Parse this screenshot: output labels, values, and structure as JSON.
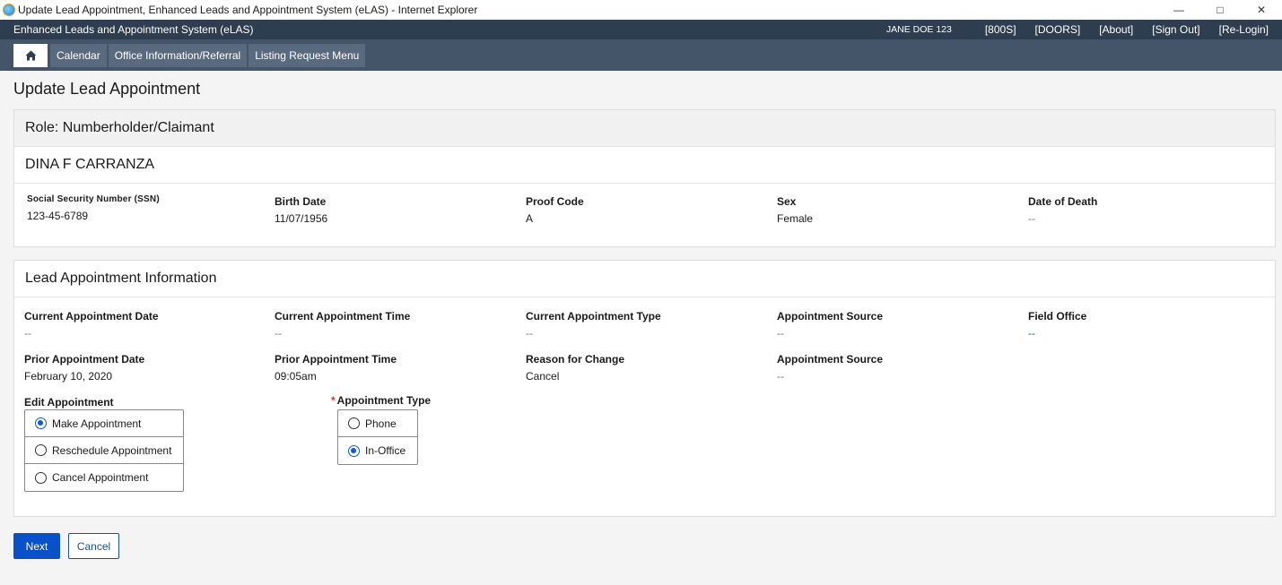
{
  "window": {
    "title": "Update Lead Appointment, Enhanced Leads and Appointment System (eLAS) - Internet Explorer",
    "minimize": "—",
    "restore": "□",
    "close": "✕"
  },
  "header": {
    "app_name": "Enhanced Leads and Appointment System (eLAS)",
    "user": "JANE DOE 123",
    "links": [
      "[800S]",
      "[DOORS]",
      "[About]",
      "[Sign Out]",
      "[Re-Login]"
    ]
  },
  "nav": {
    "home_icon": "home-icon",
    "items": [
      "Calendar",
      "Office Information/Referral",
      "Listing Request Menu"
    ]
  },
  "page_title": "Update Lead Appointment",
  "person_card": {
    "role": "Role: Numberholder/Claimant",
    "name": "DINA F CARRANZA",
    "fields": [
      {
        "label": "Social Security Number (SSN)",
        "value": "123-45-6789"
      },
      {
        "label": "Birth Date",
        "value": "11/07/1956"
      },
      {
        "label": "Proof Code",
        "value": "A"
      },
      {
        "label": "Sex",
        "value": "Female"
      },
      {
        "label": "Date of Death",
        "value": "--"
      }
    ]
  },
  "appt_card": {
    "title": "Lead Appointment Information",
    "current": [
      {
        "label": "Current Appointment Date",
        "value": "--"
      },
      {
        "label": "Current Appointment Time",
        "value": "--"
      },
      {
        "label": "Current Appointment Type",
        "value": "--"
      },
      {
        "label": "Appointment Source",
        "value": "--"
      },
      {
        "label": "Field Office",
        "value": "--"
      }
    ],
    "prior": [
      {
        "label": "Prior Appointment Date",
        "value": "February 10, 2020"
      },
      {
        "label": "Prior Appointment Time",
        "value": "09:05am"
      },
      {
        "label": "Reason for Change",
        "value": "Cancel"
      },
      {
        "label": "Appointment Source",
        "value": "--"
      }
    ],
    "edit_label": "Edit Appointment",
    "edit_options": [
      "Make Appointment",
      "Reschedule Appointment",
      "Cancel Appointment"
    ],
    "edit_selected": "Make Appointment",
    "type_required": "*",
    "type_label": "Appointment Type",
    "type_options": [
      "Phone",
      "In-Office"
    ],
    "type_selected": "In-Office"
  },
  "buttons": {
    "next": "Next",
    "cancel": "Cancel"
  },
  "colors": {
    "header_bg": "#2e3d4f",
    "nav_bg": "#44556a",
    "primary": "#0a50c8",
    "required": "#d83933"
  }
}
